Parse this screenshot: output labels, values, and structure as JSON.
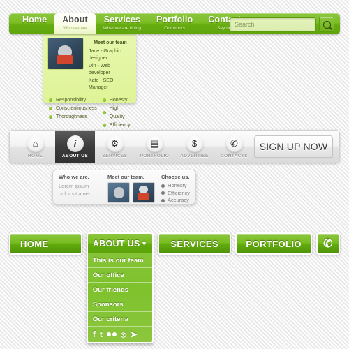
{
  "block1": {
    "tabs": [
      {
        "title": "Home",
        "sub": ""
      },
      {
        "title": "About",
        "sub": "Who we are",
        "active": true
      },
      {
        "title": "Services",
        "sub": "What we are doing"
      },
      {
        "title": "Portfolio",
        "sub": "Our works"
      },
      {
        "title": "Contacts",
        "sub": "Say hello!"
      }
    ],
    "search": {
      "placeholder": "Search",
      "icon": "search-icon"
    },
    "dropdown": {
      "team_heading": "Meet our team",
      "team_members": [
        "Jane - Graphic designer",
        "Din - Web developer",
        "Kate - SEO Manager"
      ],
      "list_left": [
        "Responsibility",
        "Conscientiousness",
        "Thoroughness"
      ],
      "list_right": [
        "Honesty",
        "High Quality",
        "Efficiency"
      ]
    }
  },
  "block2": {
    "items": [
      {
        "label": "HOME",
        "icon": "home-icon",
        "glyph": "⌂",
        "active": false
      },
      {
        "label": "ABOUT US",
        "icon": "info-icon",
        "glyph": "i",
        "active": true
      },
      {
        "label": "SERVICES",
        "icon": "gear-icon",
        "glyph": "⚙",
        "active": false
      },
      {
        "label": "PORTFOLIO",
        "icon": "briefcase-icon",
        "glyph": "▤",
        "active": false
      },
      {
        "label": "ADVERTISE",
        "icon": "dollar-icon",
        "glyph": "$",
        "active": false
      },
      {
        "label": "CONTACTS",
        "icon": "phone-icon",
        "glyph": "✆",
        "active": false
      }
    ],
    "signup_label": "SIGN UP NOW",
    "dropdown": {
      "col1_heading": "Who we are.",
      "col1_text": "Lorem ipsum dolor sit amet",
      "col2_heading": "Meet our team.",
      "col3_heading": "Choose us.",
      "col3_items": [
        "Honesty",
        "Efficiency",
        "Accuracy"
      ]
    }
  },
  "block3": {
    "buttons": [
      {
        "label": "HOME"
      },
      {
        "label": "SERVICES"
      },
      {
        "label": "PORTFOLIO"
      }
    ],
    "phone_glyph": "✆",
    "dropdown": {
      "header": "ABOUT US",
      "chevron": "▼",
      "items": [
        "This is our team",
        "Our office",
        "Our friends",
        "Sponsors",
        "Our criteria"
      ],
      "social": [
        {
          "name": "facebook-icon",
          "glyph": "f"
        },
        {
          "name": "twitter-icon",
          "glyph": "t"
        },
        {
          "name": "flickr-icon",
          "glyph": ""
        },
        {
          "name": "rss-icon",
          "glyph": "⦸"
        },
        {
          "name": "send-icon",
          "glyph": "➤"
        }
      ]
    }
  },
  "colors": {
    "green_light": "#8cc63f",
    "green_dark": "#5fa40c",
    "panel_green": "#e7f7ae",
    "gray_active": "#3c3c3c",
    "bg": "#f4f4f4"
  }
}
